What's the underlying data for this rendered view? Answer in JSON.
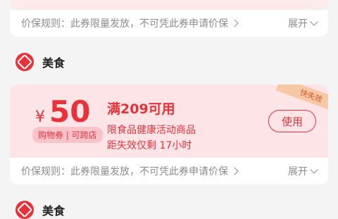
{
  "prev_card": {
    "rule_label": "价保规则：",
    "rule_text": "此券限量发放，不可凭此券申请价保",
    "expand_label": "展开"
  },
  "section": {
    "title": "美食"
  },
  "coupon": {
    "currency": "¥",
    "amount": "50",
    "tag": "购物券 | 可跨店",
    "threshold": "满209可用",
    "scope": "限食品健康活动商品",
    "expiry": "距失效仅剩 17小时",
    "ribbon": "快失效",
    "use_button": "使用",
    "rule_label": "价保规则：",
    "rule_text": "此券限量发放，不可凭此券申请价保",
    "expand_label": "展开"
  },
  "next_section": {
    "title": "美食"
  },
  "colors": {
    "accent": "#e8323a",
    "coupon_bg": "#fde4e6",
    "ribbon_bg": "#f7c8a6",
    "page_bg": "#f4f4f4"
  }
}
